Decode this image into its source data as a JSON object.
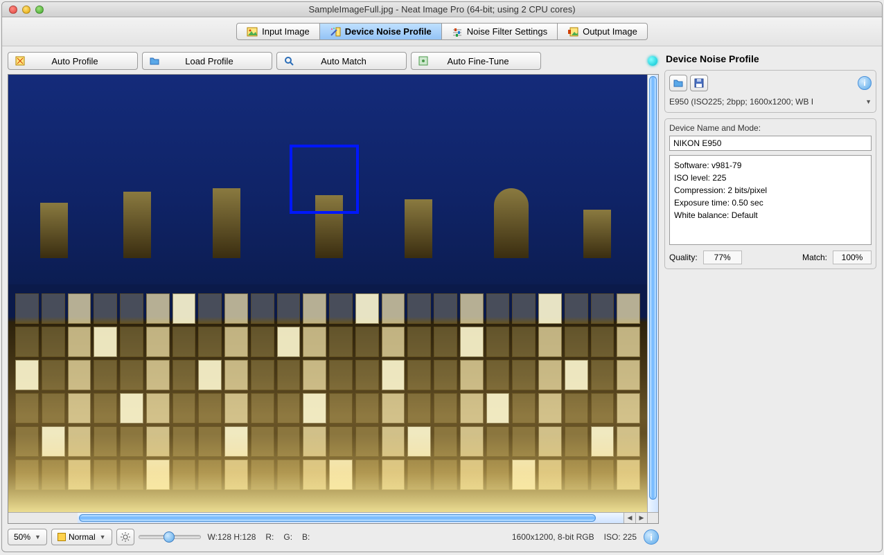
{
  "window": {
    "title": "SampleImageFull.jpg - Neat Image Pro (64-bit; using 2 CPU cores)"
  },
  "tabs": {
    "input": "Input Image",
    "profile": "Device Noise Profile",
    "filter": "Noise Filter Settings",
    "output": "Output Image"
  },
  "toolbar": {
    "auto_profile": "Auto Profile",
    "load_profile": "Load Profile",
    "auto_match": "Auto Match",
    "auto_finetune": "Auto Fine-Tune"
  },
  "status": {
    "zoom": "50%",
    "viewmode": "Normal",
    "selection": "W:128 H:128",
    "r": "R:",
    "g": "G:",
    "b": "B:",
    "image_info": "1600x1200, 8-bit RGB",
    "iso": "ISO: 225"
  },
  "panel": {
    "title": "Device Noise Profile",
    "profile_summary": "E950 (ISO225; 2bpp; 1600x1200; WB I",
    "device_label": "Device Name and Mode:",
    "device_name": "NIKON E950",
    "meta": {
      "software": "Software: v981-79",
      "iso": "ISO level: 225",
      "compression": "Compression: 2 bits/pixel",
      "exposure": "Exposure time: 0.50 sec",
      "wb": "White balance: Default"
    },
    "quality_label": "Quality:",
    "quality_value": "77%",
    "match_label": "Match:",
    "match_value": "100%"
  }
}
